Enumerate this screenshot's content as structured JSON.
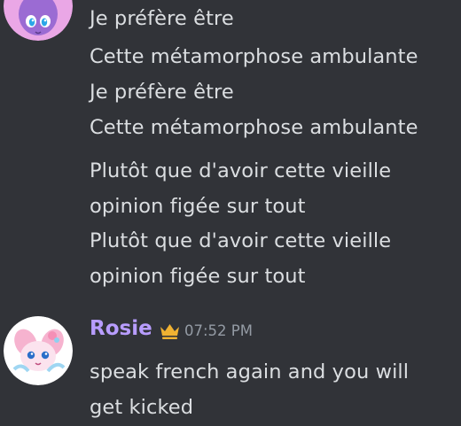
{
  "message_group_1": {
    "lines": [
      "Je préfère être",
      "Cette métamorphose ambulante",
      "Je préfère être",
      "Cette métamorphose ambulante",
      "Plutôt que d'avoir cette vieille",
      "opinion figée sur tout",
      "Plutôt que d'avoir cette vieille",
      "opinion figée sur tout"
    ]
  },
  "message_group_2": {
    "username": "Rosie",
    "username_color": "#b89dff",
    "role_icon": "crown-icon",
    "role_icon_color": "#f0b232",
    "timestamp": "07:52 PM",
    "lines": [
      "speak french again and you will",
      "get kicked"
    ]
  },
  "colors": {
    "background": "#313338",
    "text": "#dbdee1",
    "muted": "#949ba4"
  }
}
